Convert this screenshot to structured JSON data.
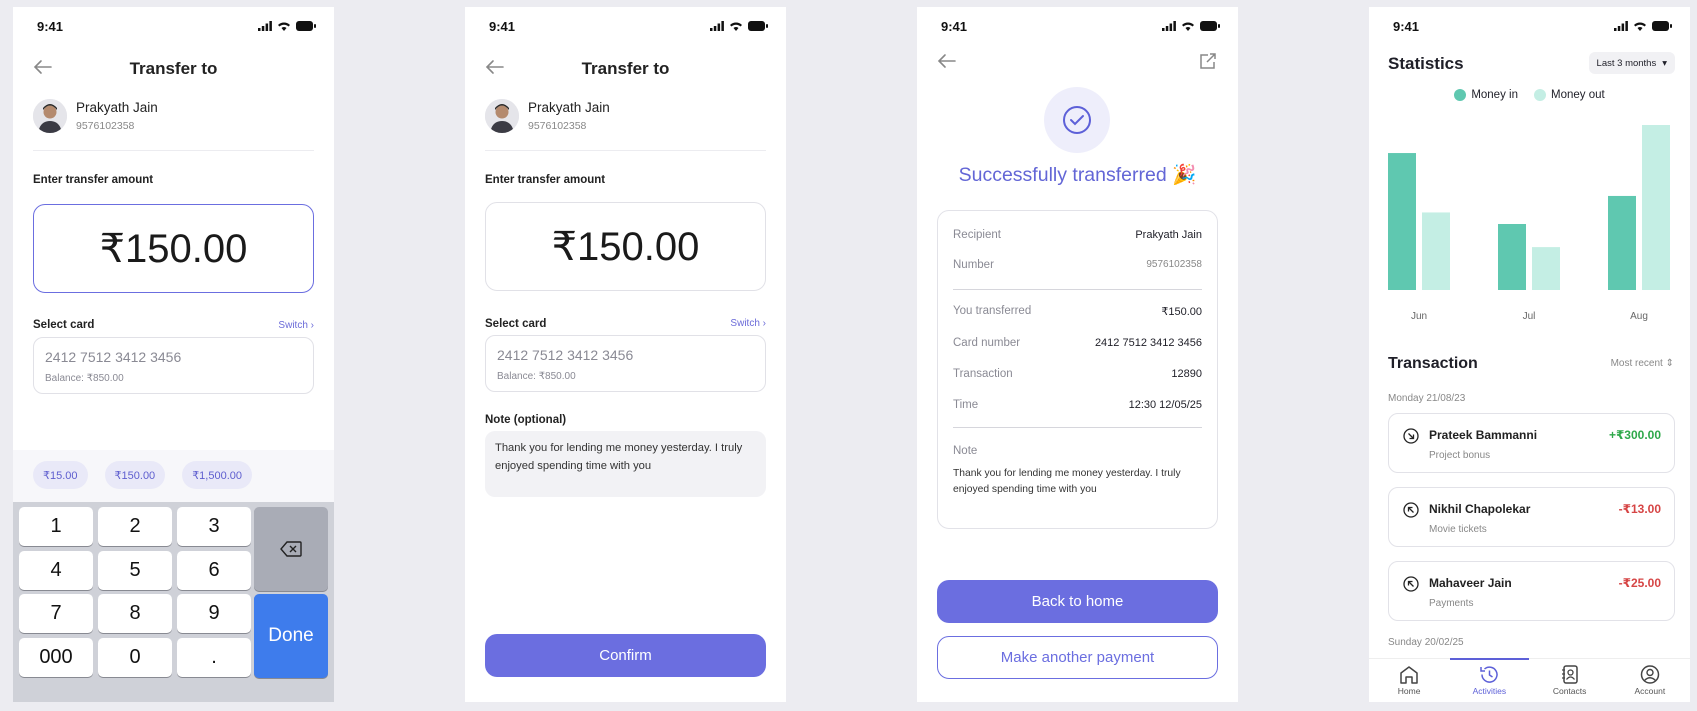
{
  "status": {
    "time": "9:41"
  },
  "screen1": {
    "title": "Transfer to",
    "recipient": {
      "name": "Prakyath Jain",
      "number": "9576102358"
    },
    "amount_label": "Enter transfer amount",
    "amount": "₹150.00",
    "select_card_label": "Select card",
    "switch_label": "Switch",
    "card_number": "2412 7512 3412 3456",
    "balance": "Balance:  ₹850.00",
    "chips": [
      "₹15.00",
      "₹150.00",
      "₹1,500.00"
    ],
    "keys": [
      "1",
      "2",
      "3",
      "4",
      "5",
      "6",
      "7",
      "8",
      "9",
      "000",
      "0",
      "."
    ],
    "done_label": "Done"
  },
  "screen2": {
    "title": "Transfer to",
    "recipient": {
      "name": "Prakyath Jain",
      "number": "9576102358"
    },
    "amount_label": "Enter transfer amount",
    "amount": "₹150.00",
    "select_card_label": "Select card",
    "switch_label": "Switch",
    "card_number": "2412 7512 3412 3456",
    "balance": "Balance:  ₹850.00",
    "note_label": "Note (optional)",
    "note": "Thank you for lending me money yesterday. I truly enjoyed spending time with you",
    "confirm_label": "Confirm"
  },
  "screen3": {
    "success_title": "Successfully transferred 🎉",
    "recipient_label": "Recipient",
    "recipient_value": "Prakyath Jain",
    "number_label": "Number",
    "number_value": "9576102358",
    "transferred_label": "You transferred",
    "transferred_value": "₹150.00",
    "card_label": "Card number",
    "card_value": "2412 7512 3412 3456",
    "transaction_label": "Transaction",
    "transaction_value": "12890",
    "time_label": "Time",
    "time_value": "12:30 12/05/25",
    "note_label": "Note",
    "note_value": "Thank you for lending me money yesterday. I truly enjoyed spending time with you",
    "back_home_label": "Back to home",
    "another_payment_label": "Make another payment"
  },
  "screen4": {
    "title": "Statistics",
    "range": "Last 3 months",
    "legend": [
      {
        "name": "Money in",
        "color": "#5fc8b0"
      },
      {
        "name": "Money out",
        "color": "#c4eee4"
      }
    ],
    "transaction_title": "Transaction",
    "sort_label": "Most recent",
    "day1": "Monday  21/08/23",
    "day2": "Sunday  20/02/25",
    "transactions": [
      {
        "name": "Prateek Bammanni",
        "sub": "Project bonus",
        "amount": "+₹300.00",
        "dir": "in"
      },
      {
        "name": "Nikhil Chapolekar",
        "sub": "Movie tickets",
        "amount": "-₹13.00",
        "dir": "out"
      },
      {
        "name": "Mahaveer Jain",
        "sub": "Payments",
        "amount": "-₹25.00",
        "dir": "out"
      }
    ],
    "nav": [
      "Home",
      "Activities",
      "Contacts",
      "Account"
    ],
    "colors": {
      "in_amount": "#2ea84a",
      "out_amount": "#d64545",
      "accent": "#6b6ee0"
    }
  },
  "chart_data": {
    "type": "bar",
    "categories": [
      "Jun",
      "Jul",
      "Aug"
    ],
    "series": [
      {
        "name": "Money in",
        "values": [
          83,
          40,
          57
        ]
      },
      {
        "name": "Money out",
        "values": [
          47,
          26,
          100
        ]
      }
    ],
    "ylim": [
      0,
      100
    ],
    "legend_position": "top-center",
    "grid": false
  }
}
